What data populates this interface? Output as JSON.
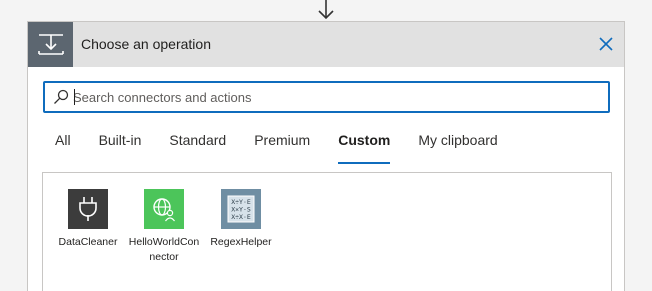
{
  "header": {
    "title": "Choose an operation",
    "close_label": "Close"
  },
  "search": {
    "placeholder": "Search connectors and actions",
    "value": ""
  },
  "tabs": [
    {
      "label": "All",
      "active": false
    },
    {
      "label": "Built-in",
      "active": false
    },
    {
      "label": "Standard",
      "active": false
    },
    {
      "label": "Premium",
      "active": false
    },
    {
      "label": "Custom",
      "active": true
    },
    {
      "label": "My clipboard",
      "active": false
    }
  ],
  "connectors": [
    {
      "name": "DataCleaner",
      "icon": "plug-icon",
      "color": "#3c3c3c"
    },
    {
      "name": "HelloWorldConnector",
      "icon": "globe-person-icon",
      "color": "#4cc55a"
    },
    {
      "name": "RegexHelper",
      "icon": "regex-grid-icon",
      "color": "#6f8ea3"
    }
  ],
  "colors": {
    "accent": "#0f6cbd",
    "header_bg": "#e1e1e1",
    "header_icon_bg": "#5c6670"
  }
}
